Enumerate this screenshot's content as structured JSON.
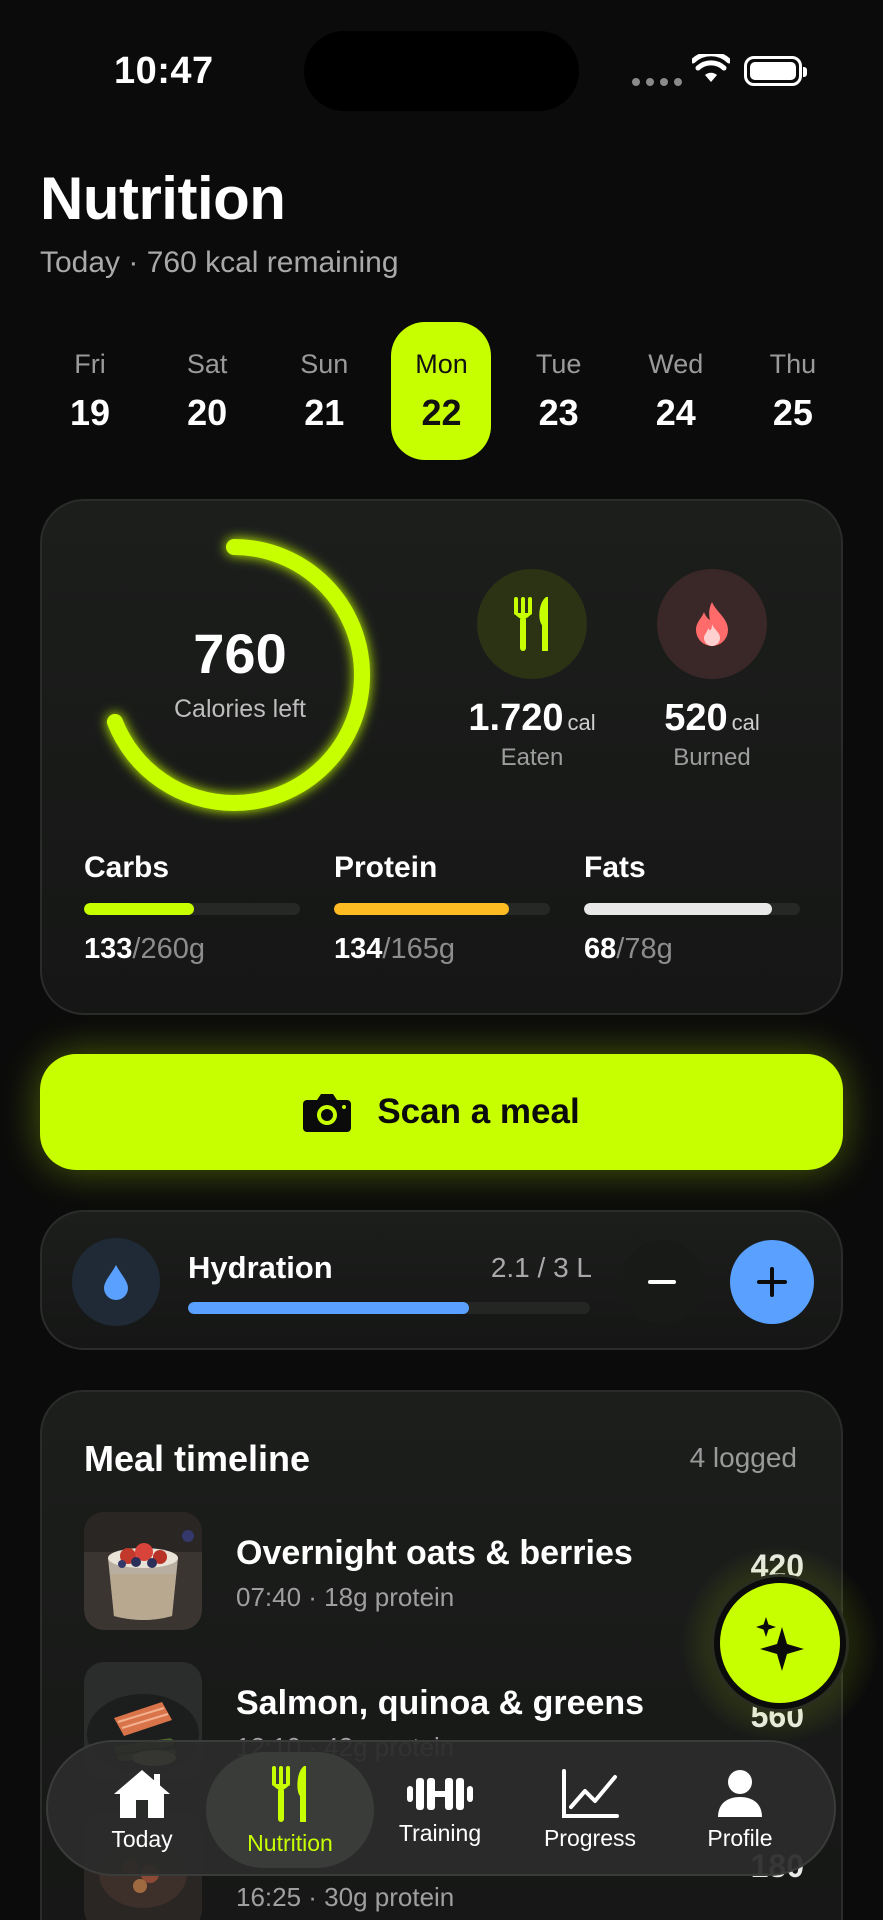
{
  "status_bar": {
    "time": "10:47"
  },
  "header": {
    "title": "Nutrition",
    "subtitle": "Today · 760 kcal remaining"
  },
  "dates": [
    {
      "name": "Fri",
      "num": "19"
    },
    {
      "name": "Sat",
      "num": "20"
    },
    {
      "name": "Sun",
      "num": "21"
    },
    {
      "name": "Mon",
      "num": "22",
      "active": true
    },
    {
      "name": "Tue",
      "num": "23"
    },
    {
      "name": "Wed",
      "num": "24"
    },
    {
      "name": "Thu",
      "num": "25"
    }
  ],
  "summary": {
    "calories_left": "760",
    "calories_left_label": "Calories left",
    "ring_progress": 0.69,
    "eaten": {
      "value": "1.720",
      "unit": "cal",
      "label": "Eaten",
      "icon": "fork-knife-icon"
    },
    "burned": {
      "value": "520",
      "unit": "cal",
      "label": "Burned",
      "icon": "flame-icon"
    },
    "macros": [
      {
        "name": "Carbs",
        "current": "133",
        "target": "/260g",
        "progress": 0.51,
        "color": "#c8ff00"
      },
      {
        "name": "Protein",
        "current": "134",
        "target": "/165g",
        "progress": 0.81,
        "color": "#ffbb22"
      },
      {
        "name": "Fats",
        "current": "68",
        "target": "/78g",
        "progress": 0.87,
        "color": "#e8e8e8"
      }
    ]
  },
  "scan": {
    "label": "Scan a meal",
    "icon": "camera-icon"
  },
  "hydration": {
    "title": "Hydration",
    "value": "2.1 / 3 L",
    "progress": 0.7,
    "icon": "water-drop-icon"
  },
  "timeline": {
    "title": "Meal timeline",
    "count": "4 logged",
    "meals": [
      {
        "name": "Overnight oats & berries",
        "meta": "07:40 · 18g protein",
        "cal": "420"
      },
      {
        "name": "Salmon, quinoa & greens",
        "meta": "12:10 · 42g protein",
        "cal": "560"
      },
      {
        "name": "",
        "meta": "16:25 · 30g protein",
        "cal": "180"
      }
    ]
  },
  "tabs": [
    {
      "label": "Today",
      "icon": "house-icon"
    },
    {
      "label": "Nutrition",
      "icon": "fork-knife-icon",
      "active": true
    },
    {
      "label": "Training",
      "icon": "dumbbell-icon"
    },
    {
      "label": "Progress",
      "icon": "chart-icon"
    },
    {
      "label": "Profile",
      "icon": "person-icon"
    }
  ],
  "colors": {
    "accent": "#c8ff00",
    "protein": "#ffbb22",
    "water": "#5aa0ff",
    "background": "#0b0b0b"
  }
}
